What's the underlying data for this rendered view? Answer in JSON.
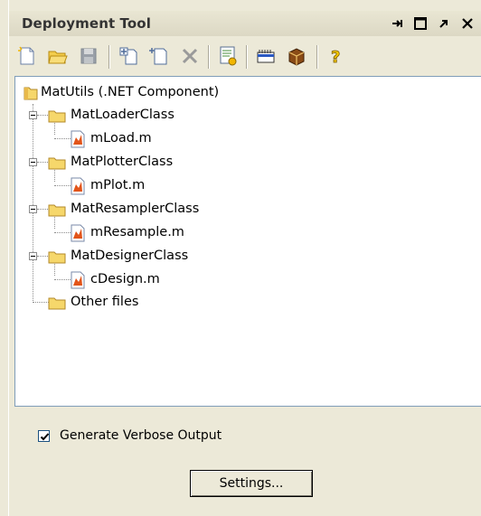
{
  "window": {
    "title": "Deployment Tool",
    "controls": [
      "pin-icon",
      "maximize-icon",
      "undock-icon",
      "close-icon"
    ]
  },
  "toolbar": {
    "buttons": [
      "new-project-icon",
      "open-project-icon",
      "save-project-icon",
      "add-class-icon",
      "add-file-icon",
      "remove-icon",
      "build-icon",
      "package-icon",
      "settings-package-icon",
      "help-icon"
    ]
  },
  "tree": {
    "root": "MatUtils (.NET Component)",
    "classes": [
      {
        "name": "MatLoaderClass",
        "file": "mLoad.m"
      },
      {
        "name": "MatPlotterClass",
        "file": "mPlot.m"
      },
      {
        "name": "MatResamplerClass",
        "file": "mResample.m"
      },
      {
        "name": "MatDesignerClass",
        "file": "cDesign.m"
      }
    ],
    "other": "Other files"
  },
  "options": {
    "verbose_label": "Generate Verbose Output",
    "verbose_checked": true
  },
  "settings_button": "Settings...",
  "colors": {
    "panel_bg": "#ece9d8",
    "folder": "#f6d76b",
    "tree_bg": "#ffffff"
  }
}
